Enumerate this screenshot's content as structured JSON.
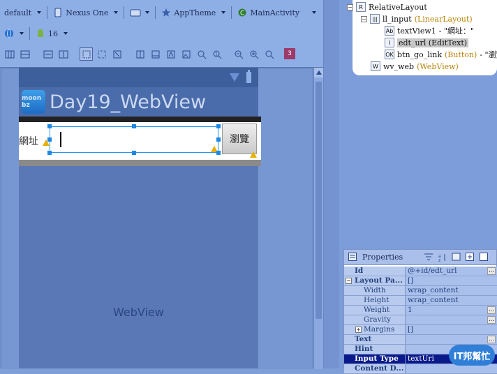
{
  "toolbar": {
    "config": "default",
    "device": "Nexus One",
    "theme": "AppTheme",
    "activity": "MainActivity",
    "api_level": "16",
    "error_count": "3"
  },
  "device": {
    "app_title": "Day19_WebView",
    "app_icon_text": "moon bz",
    "label_text": "網址",
    "button_text": "瀏覽",
    "webview_text": "WebView"
  },
  "outline": {
    "root": "RelativeLayout",
    "ll_input": "ll_input",
    "ll_input_type": "(LinearLayout)",
    "textview1": "textView1",
    "textview1_value": "- \"網址：\"",
    "edt_url": "edt_url",
    "edt_url_type": "(EditText)",
    "btn": "btn_go_link",
    "btn_type": "(Button)",
    "btn_value": "- \"瀏覽",
    "webview": "wv_web",
    "webview_type": "(WebView)"
  },
  "properties": {
    "title": "Properties",
    "rows": [
      {
        "name": "Id",
        "value": "@+id/edt_url"
      },
      {
        "name": "Layout Pa...",
        "value": "[]"
      },
      {
        "name": "Width",
        "value": "wrap_content"
      },
      {
        "name": "Height",
        "value": "wrap_content"
      },
      {
        "name": "Weight",
        "value": "1"
      },
      {
        "name": "Gravity",
        "value": ""
      },
      {
        "name": "Margins",
        "value": "[]"
      },
      {
        "name": "Text",
        "value": ""
      },
      {
        "name": "Hint",
        "value": ""
      },
      {
        "name": "Input Type",
        "value": "textUri"
      },
      {
        "name": "Content D...",
        "value": ""
      }
    ]
  },
  "watermark": "IT邦幫忙",
  "colors": {
    "accent": "#1e88e5",
    "selection": "#0a1a8a"
  }
}
